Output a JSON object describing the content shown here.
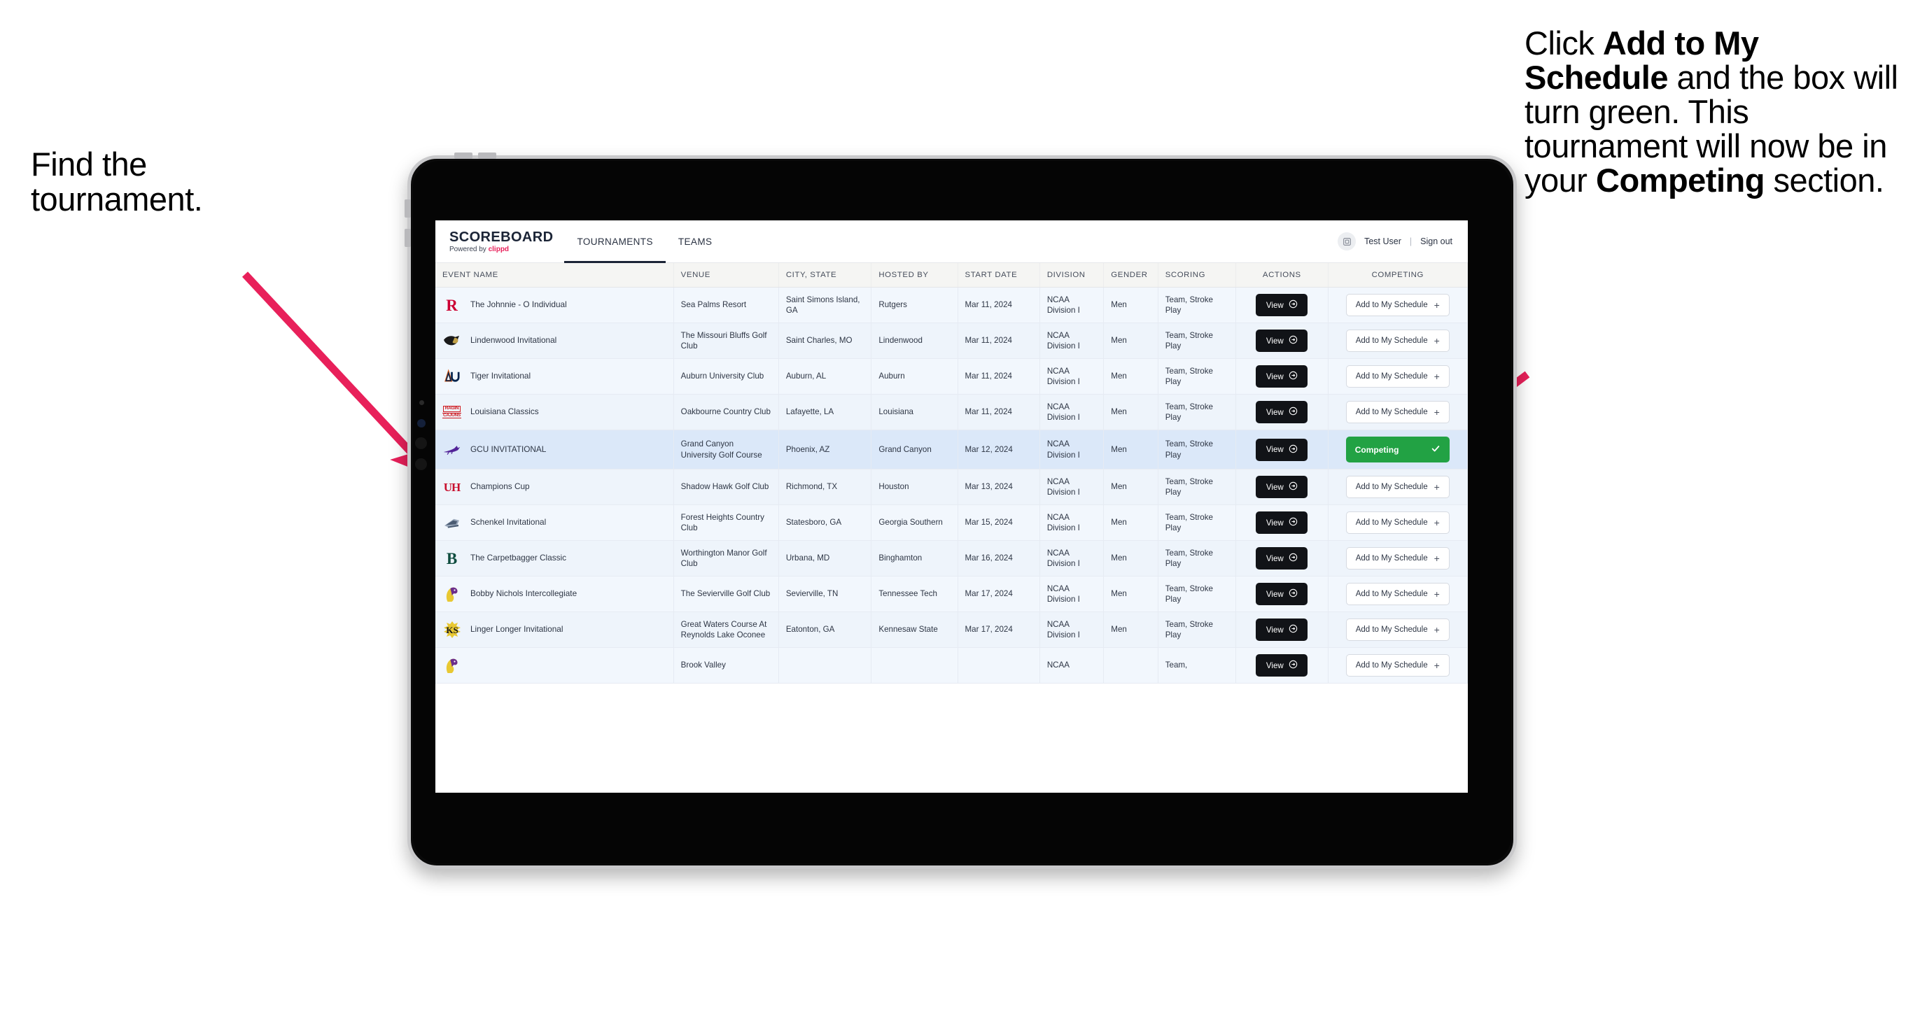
{
  "annotations": {
    "left": "Find the tournament.",
    "right_segments": [
      {
        "t": "Click ",
        "b": false
      },
      {
        "t": "Add to My Schedule",
        "b": true
      },
      {
        "t": " and the box will turn green. This tournament will now be in your ",
        "b": false
      },
      {
        "t": "Competing",
        "b": true
      },
      {
        "t": " section.",
        "b": false
      }
    ],
    "arrow_color": "#e8205a"
  },
  "app": {
    "brand": {
      "name": "SCOREBOARD",
      "powered_prefix": "Powered by ",
      "powered_brand": "clippd"
    },
    "nav": [
      {
        "label": "TOURNAMENTS",
        "active": true
      },
      {
        "label": "TEAMS",
        "active": false
      }
    ],
    "user": {
      "avatar_icon": "user-badge-icon",
      "name": "Test User",
      "separator": "|",
      "signout": "Sign out"
    },
    "table": {
      "columns": [
        {
          "key": "event",
          "label": "EVENT NAME",
          "align": "left"
        },
        {
          "key": "venue",
          "label": "VENUE",
          "align": "left"
        },
        {
          "key": "city",
          "label": "CITY, STATE",
          "align": "left"
        },
        {
          "key": "host",
          "label": "HOSTED BY",
          "align": "left"
        },
        {
          "key": "date",
          "label": "START DATE",
          "align": "left"
        },
        {
          "key": "division",
          "label": "DIVISION",
          "align": "left"
        },
        {
          "key": "gender",
          "label": "GENDER",
          "align": "left"
        },
        {
          "key": "scoring",
          "label": "SCORING",
          "align": "left"
        },
        {
          "key": "actions",
          "label": "ACTIONS",
          "align": "center"
        },
        {
          "key": "competing",
          "label": "COMPETING",
          "align": "center"
        }
      ],
      "view_label": "View",
      "add_label": "Add to My Schedule",
      "add_plus": "+",
      "competing_label": "Competing",
      "rows": [
        {
          "event": "The Johnnie - O Individual",
          "venue": "Sea Palms Resort",
          "city": "Saint Simons Island, GA",
          "host": "Rutgers",
          "date": "Mar 11, 2024",
          "division": "NCAA Division I",
          "gender": "Men",
          "scoring": "Team, Stroke Play",
          "competing": false,
          "logo": {
            "type": "letter",
            "text": "R",
            "fg": "#cc0033",
            "bg": "transparent",
            "serif": true
          }
        },
        {
          "event": "Lindenwood Invitational",
          "venue": "The Missouri Bluffs Golf Club",
          "city": "Saint Charles, MO",
          "host": "Lindenwood",
          "date": "Mar 11, 2024",
          "division": "NCAA Division I",
          "gender": "Men",
          "scoring": "Team, Stroke Play",
          "competing": false,
          "logo": {
            "type": "lion",
            "fg": "#1a1a1a",
            "accent": "#c2a24a"
          }
        },
        {
          "event": "Tiger Invitational",
          "venue": "Auburn University Club",
          "city": "Auburn, AL",
          "host": "Auburn",
          "date": "Mar 11, 2024",
          "division": "NCAA Division I",
          "gender": "Men",
          "scoring": "Team, Stroke Play",
          "competing": false,
          "logo": {
            "type": "au",
            "fg": "#03244d",
            "accent": "#dd550c"
          }
        },
        {
          "event": "Louisiana Classics",
          "venue": "Oakbourne Country Club",
          "city": "Lafayette, LA",
          "host": "Louisiana",
          "date": "Mar 11, 2024",
          "division": "NCAA Division I",
          "gender": "Men",
          "scoring": "Team, Stroke Play",
          "competing": false,
          "logo": {
            "type": "cajuns",
            "line1": "RAGIN",
            "line2": "CAJUNS",
            "fg": "#ce181e"
          }
        },
        {
          "event": "GCU INVITATIONAL",
          "venue": "Grand Canyon University Golf Course",
          "city": "Phoenix, AZ",
          "host": "Grand Canyon",
          "date": "Mar 12, 2024",
          "division": "NCAA Division I",
          "gender": "Men",
          "scoring": "Team, Stroke Play",
          "competing": true,
          "selected": true,
          "logo": {
            "type": "lope",
            "fg": "#522398"
          }
        },
        {
          "event": "Champions Cup",
          "venue": "Shadow Hawk Golf Club",
          "city": "Richmond, TX",
          "host": "Houston",
          "date": "Mar 13, 2024",
          "division": "NCAA Division I",
          "gender": "Men",
          "scoring": "Team, Stroke Play",
          "competing": false,
          "logo": {
            "type": "uh",
            "text": "UH",
            "fg": "#c8102e"
          }
        },
        {
          "event": "Schenkel Invitational",
          "venue": "Forest Heights Country Club",
          "city": "Statesboro, GA",
          "host": "Georgia Southern",
          "date": "Mar 15, 2024",
          "division": "NCAA Division I",
          "gender": "Men",
          "scoring": "Team, Stroke Play",
          "competing": false,
          "logo": {
            "type": "gs",
            "fg": "#4a5b72",
            "accent": "#9aa8bb"
          }
        },
        {
          "event": "The Carpetbagger Classic",
          "venue": "Worthington Manor Golf Club",
          "city": "Urbana, MD",
          "host": "Binghamton",
          "date": "Mar 16, 2024",
          "division": "NCAA Division I",
          "gender": "Men",
          "scoring": "Team, Stroke Play",
          "competing": false,
          "logo": {
            "type": "letter",
            "text": "B",
            "fg": "#0f4d3f",
            "bg": "transparent",
            "serif": true
          }
        },
        {
          "event": "Bobby Nichols Intercollegiate",
          "venue": "The Sevierville Golf Club",
          "city": "Sevierville, TN",
          "host": "Tennessee Tech",
          "date": "Mar 17, 2024",
          "division": "NCAA Division I",
          "gender": "Men",
          "scoring": "Team, Stroke Play",
          "competing": false,
          "logo": {
            "type": "eagle",
            "fg": "#6b2d8c",
            "accent": "#e8c832"
          }
        },
        {
          "event": "Linger Longer Invitational",
          "venue": "Great Waters Course At Reynolds Lake Oconee",
          "city": "Eatonton, GA",
          "host": "Kennesaw State",
          "date": "Mar 17, 2024",
          "division": "NCAA Division I",
          "gender": "Men",
          "scoring": "Team, Stroke Play",
          "competing": false,
          "logo": {
            "type": "ksu",
            "text": "KS",
            "fg": "#e8c832",
            "accent": "#1a1a1a"
          }
        },
        {
          "event": "",
          "venue": "Brook Valley",
          "city": "",
          "host": "",
          "date": "",
          "division": "NCAA",
          "gender": "",
          "scoring": "Team,",
          "competing": false,
          "clipped": true,
          "logo": {
            "type": "eagle",
            "fg": "#6b2d8c",
            "accent": "#e8c832"
          }
        }
      ]
    }
  }
}
